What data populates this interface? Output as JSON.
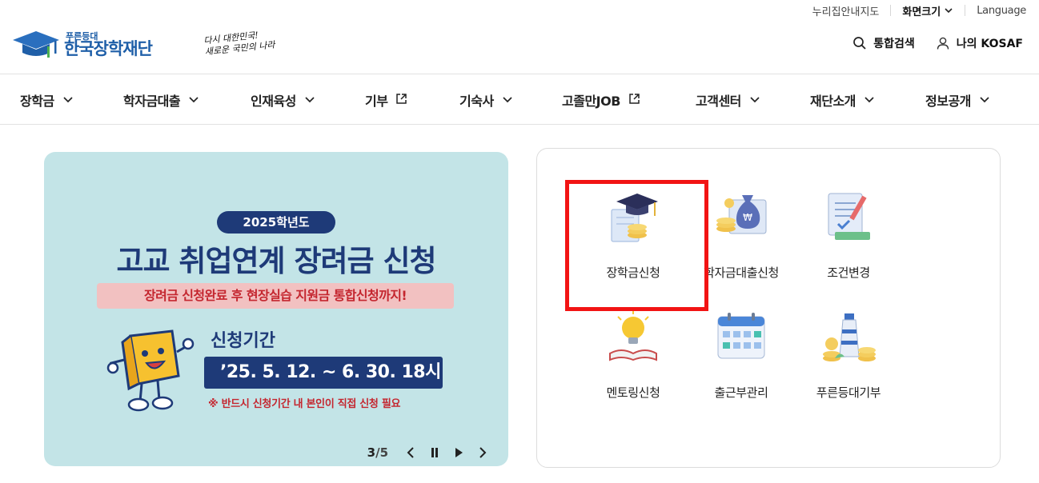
{
  "util": {
    "accessibility_map": "누리집안내지도",
    "font_size": "화면크기",
    "language": "Language"
  },
  "logo": {
    "small": "푸른등대",
    "big": "한국장학재단"
  },
  "slogan": {
    "line1": "다시 대한민국!",
    "line2": "새로운 국민의 나라"
  },
  "header": {
    "search": "통합검색",
    "my": "나의 KOSAF"
  },
  "gnb": [
    {
      "label": "장학금",
      "icon": "chevron-down-icon"
    },
    {
      "label": "학자금대출",
      "icon": "chevron-down-icon"
    },
    {
      "label": "인재육성",
      "icon": "chevron-down-icon"
    },
    {
      "label": "기부",
      "icon": "external-link-icon"
    },
    {
      "label": "기숙사",
      "icon": "chevron-down-icon"
    },
    {
      "label": "고졸만JOB",
      "icon": "external-link-icon"
    },
    {
      "label": "고객센터",
      "icon": "chevron-down-icon"
    },
    {
      "label": "재단소개",
      "icon": "chevron-down-icon"
    },
    {
      "label": "정보공개",
      "icon": "chevron-down-icon"
    }
  ],
  "banner": {
    "year": "2025학년도",
    "title": "고교 취업연계 장려금 신청",
    "subtitle": "장려금 신청완료 후 현장실습 지원금 통합신청까지!",
    "period_label": "신청기간",
    "period": "’25. 5. 12. ~ 6. 30. 18시",
    "note": "※ 반드시 신청기간 내 본인이 직접 신청 필요",
    "current": "3",
    "separator": "/",
    "total": "5"
  },
  "quick": [
    {
      "label": "장학금신청",
      "icon": "graduation-cap-icon"
    },
    {
      "label": "학자금대출신청",
      "icon": "money-bag-icon"
    },
    {
      "label": "조건변경",
      "icon": "document-icon"
    },
    {
      "label": "멘토링신청",
      "icon": "lightbulb-book-icon"
    },
    {
      "label": "출근부관리",
      "icon": "calendar-icon"
    },
    {
      "label": "푸른등대기부",
      "icon": "lighthouse-coins-icon"
    }
  ],
  "colors": {
    "brand": "#1f5fa8",
    "navy": "#1e3a78",
    "banner_bg": "#c3e4e7",
    "highlight": "#f21414",
    "alert_red": "#c4262f"
  }
}
